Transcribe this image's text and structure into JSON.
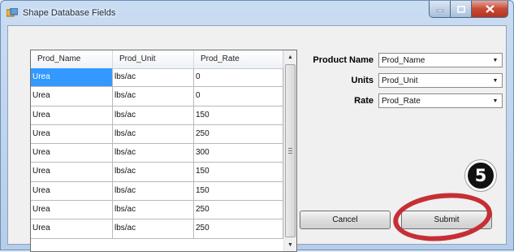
{
  "window": {
    "title": "Shape Database Fields",
    "colors": {
      "accent": "#3399ff",
      "close": "#c74a35",
      "annotation": "#c62f35"
    }
  },
  "grid": {
    "columns": [
      "Prod_Name",
      "Prod_Unit",
      "Prod_Rate"
    ],
    "rows": [
      [
        "Urea",
        "lbs/ac",
        "0"
      ],
      [
        "Urea",
        "lbs/ac",
        "0"
      ],
      [
        "Urea",
        "lbs/ac",
        "150"
      ],
      [
        "Urea",
        "lbs/ac",
        "250"
      ],
      [
        "Urea",
        "lbs/ac",
        "300"
      ],
      [
        "Urea",
        "lbs/ac",
        "150"
      ],
      [
        "Urea",
        "lbs/ac",
        "150"
      ],
      [
        "Urea",
        "lbs/ac",
        "250"
      ],
      [
        "Urea",
        "lbs/ac",
        "250"
      ]
    ],
    "selected_cell": "Urea"
  },
  "fields": {
    "product_name": {
      "label": "Product Name",
      "value": "Prod_Name"
    },
    "units": {
      "label": "Units",
      "value": "Prod_Unit"
    },
    "rate": {
      "label": "Rate",
      "value": "Prod_Rate"
    }
  },
  "buttons": {
    "cancel": "Cancel",
    "submit": "Submit"
  },
  "annotation": {
    "step": "5"
  },
  "icons": [
    "app-icon",
    "minimize-icon",
    "maximize-icon",
    "close-icon",
    "scroll-up-icon",
    "scroll-down-icon",
    "dropdown-arrow-icon"
  ]
}
